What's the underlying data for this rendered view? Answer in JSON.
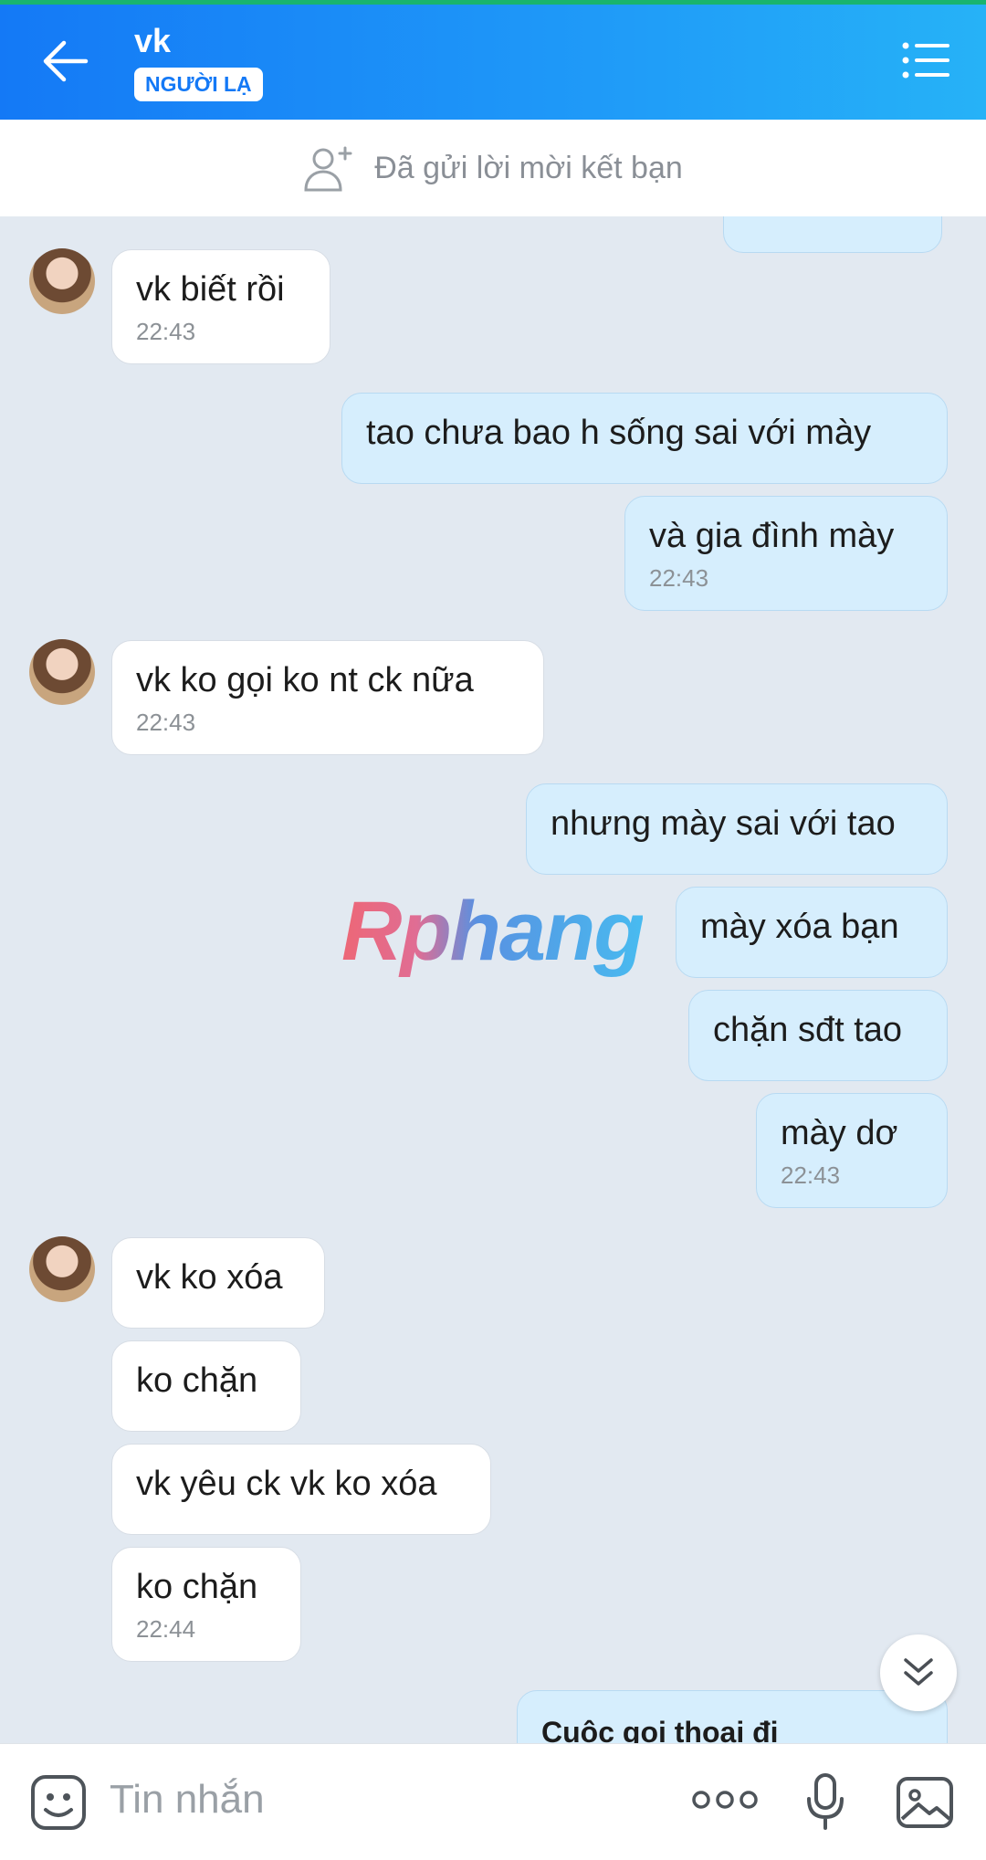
{
  "header": {
    "title": "vk",
    "badge": "NGƯỜI LẠ"
  },
  "friend_bar": {
    "text": "Đã gửi lời mời kết bạn"
  },
  "messages": [
    {
      "side": "in",
      "text": "vk biết rồi",
      "time": "22:43"
    },
    {
      "side": "out",
      "text": "tao chưa bao h sống sai với mày",
      "time": ""
    },
    {
      "side": "out",
      "text": "và gia đình mày",
      "time": "22:43"
    },
    {
      "side": "in",
      "text": " vk ko gọi ko nt ck nữa",
      "time": "22:43"
    },
    {
      "side": "out",
      "text": "nhưng mày sai với tao",
      "time": ""
    },
    {
      "side": "out",
      "text": "mày xóa bạn",
      "time": ""
    },
    {
      "side": "out",
      "text": "chặn sđt tao",
      "time": ""
    },
    {
      "side": "out",
      "text": "mày dơ",
      "time": "22:43"
    },
    {
      "side": "in",
      "text": "vk ko xóa",
      "time": ""
    },
    {
      "side": "in",
      "text": "ko chặn",
      "time": ""
    },
    {
      "side": "in",
      "text": "vk yêu ck vk ko xóa",
      "time": ""
    },
    {
      "side": "in",
      "text": "ko chặn",
      "time": "22:44"
    },
    {
      "side": "out",
      "text": "Cuộc gọi thoại đi",
      "time": ""
    }
  ],
  "watermark": "Rphang",
  "input": {
    "placeholder": "Tin nhắn"
  },
  "icons": {
    "back": "arrow-left-icon",
    "menu": "list-menu-icon",
    "add_friend": "add-person-icon",
    "scroll": "double-chevron-down-icon",
    "sticker": "sticker-icon",
    "more": "more-dots-icon",
    "mic": "microphone-icon",
    "image": "image-icon"
  },
  "colors": {
    "header_start": "#1479f6",
    "header_end": "#26b2f7",
    "outgoing_bubble": "#d6eefd",
    "incoming_bubble": "#ffffff",
    "chat_background": "#e2e9f1"
  }
}
